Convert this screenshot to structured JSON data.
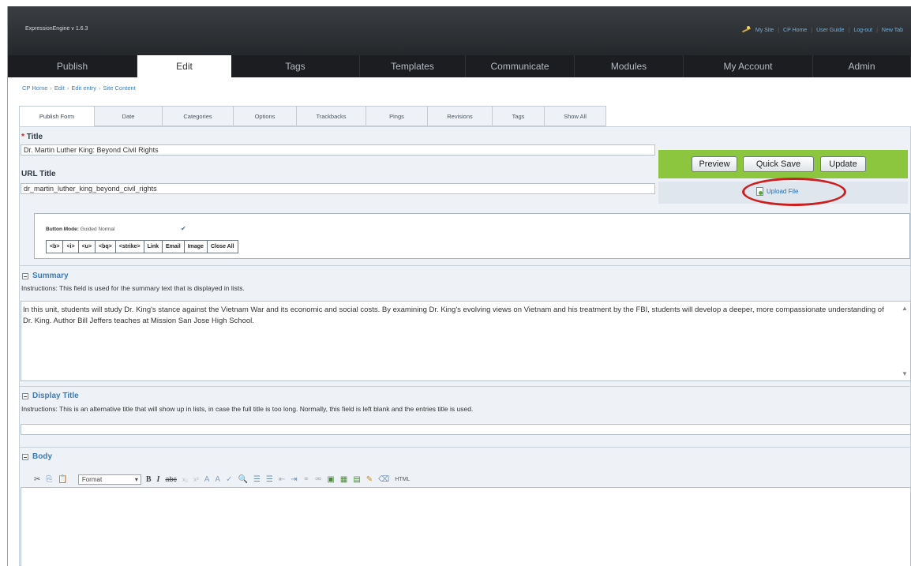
{
  "header": {
    "app_name": "ExpressionEngine",
    "version": "v 1.6.3",
    "links": [
      "My Site",
      "CP Home",
      "User Guide",
      "Log-out",
      "New Tab"
    ]
  },
  "nav": {
    "tabs": [
      "Publish",
      "Edit",
      "Tags",
      "Templates",
      "Communicate",
      "Modules",
      "My Account",
      "Admin"
    ],
    "active": "Edit"
  },
  "breadcrumb": [
    "CP Home",
    "Edit",
    "Edit entry",
    "Site Content"
  ],
  "subtabs": {
    "items": [
      "Publish Form",
      "Date",
      "Categories",
      "Options",
      "Trackbacks",
      "Pings",
      "Revisions",
      "Tags",
      "Show All"
    ],
    "active": "Publish Form"
  },
  "form": {
    "title_label": "Title",
    "title_required_mark": "*",
    "title_value": "Dr. Martin Luther King: Beyond Civil Rights",
    "url_title_label": "URL Title",
    "url_title_value": "dr_martin_luther_king_beyond_civil_rights"
  },
  "actions": {
    "preview": "Preview",
    "quick_save": "Quick Save",
    "update": "Update",
    "upload_file": "Upload File"
  },
  "button_mode": {
    "label": "Button Mode:",
    "guided": "Guided",
    "normal": "Normal",
    "buttons": [
      "<b>",
      "<i>",
      "<u>",
      "<bq>",
      "<strike>",
      "Link",
      "Email",
      "Image",
      "Close All"
    ]
  },
  "summary": {
    "heading": "Summary",
    "instructions": "Instructions: This field is used for the summary text that is displayed in lists.",
    "text": "In this unit, students will study Dr. King's stance against the Vietnam War and its economic and social costs. By examining Dr. King's evolving views on Vietnam and his treatment by the FBI, students will develop a deeper, more compassionate understanding of Dr. King. Author Bill Jeffers teaches at Mission San Jose High School."
  },
  "display_title": {
    "heading": "Display Title",
    "instructions": "Instructions: This is an alternative title that will show up in lists, in case the full title is too long. Normally, this field is left blank and the entries title is used.",
    "value": ""
  },
  "body": {
    "heading": "Body",
    "format_select": "Format"
  },
  "colors": {
    "header_bg": "#2b2e31",
    "accent_green": "#8cc63f",
    "link_blue": "#3b7bb7",
    "highlight_red": "#cc1f1f"
  }
}
